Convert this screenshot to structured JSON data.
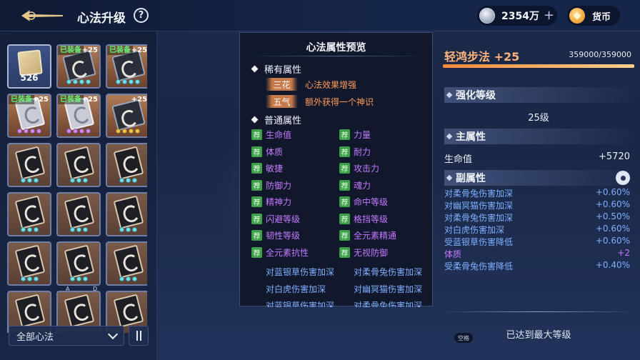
{
  "header": {
    "title": "心法升级",
    "help_label": "?",
    "silver_amount": "2354万",
    "plus_label": "+",
    "gold_label": "货币"
  },
  "inventory": {
    "items": [
      {
        "type": "scroll",
        "count": "526",
        "selected": true
      },
      {
        "type": "book",
        "equip": "已装备",
        "level": "+25",
        "dots": [
          "c",
          "c",
          "c",
          "c"
        ]
      },
      {
        "type": "book",
        "equip": "已装备",
        "level": "+25",
        "dots": [
          "c",
          "c",
          "c",
          "c"
        ]
      },
      {
        "type": "silverbook",
        "equip": "已装备",
        "level": "+25",
        "dots": [
          "p",
          "p",
          "p",
          "p"
        ]
      },
      {
        "type": "silverbook",
        "equip": "已装备",
        "level": "+25",
        "dots": [
          "p",
          "p",
          "p",
          "p"
        ]
      },
      {
        "type": "book",
        "level": "+25",
        "dots": [
          "g",
          "g",
          "g",
          "g"
        ]
      },
      {
        "type": "rune",
        "dots": [
          "c",
          "c",
          "c"
        ]
      },
      {
        "type": "rune",
        "dots": [
          "c",
          "c",
          "c"
        ]
      },
      {
        "type": "rune",
        "dots": [
          "c",
          "c",
          "c"
        ]
      },
      {
        "type": "rune",
        "dots": [
          "c",
          "c",
          "c"
        ]
      },
      {
        "type": "rune",
        "dots": [
          "c",
          "c",
          "c"
        ]
      },
      {
        "type": "rune",
        "dots": [
          "c",
          "c",
          "c"
        ]
      },
      {
        "type": "rune",
        "dots": [
          "c",
          "c",
          "c"
        ]
      },
      {
        "type": "rune",
        "dots": [
          "c",
          "c",
          "c"
        ]
      },
      {
        "type": "rune",
        "dots": [
          "c",
          "c",
          "c"
        ]
      },
      {
        "type": "rune",
        "dots": []
      },
      {
        "type": "rune",
        "dots": []
      },
      {
        "type": "rune",
        "dots": []
      }
    ],
    "key_hints": [
      "A",
      "D"
    ],
    "filter_label": "全部心法"
  },
  "preview": {
    "title": "心法属性预览",
    "rare_title": "稀有属性",
    "rare": [
      {
        "tag": "三花",
        "text": "心法效果增强"
      },
      {
        "tag": "五气",
        "text": "额外获得一个神识"
      }
    ],
    "normal_title": "普通属性",
    "rec_label": "荐",
    "attrs": [
      "生命值",
      "力量",
      "体质",
      "耐力",
      "敏捷",
      "攻击力",
      "防御力",
      "魂力",
      "精神力",
      "命中等级",
      "闪避等级",
      "格挡等级",
      "韧性等级",
      "全元素精通",
      "全元素抗性",
      "无视防御"
    ],
    "blue_attrs": [
      "对蓝银草伤害加深",
      "对柔骨兔伤害加深",
      "对白虎伤害加深",
      "对幽冥猫伤害加深",
      "对蓝银草伤害加深",
      "对柔骨兔伤害加深"
    ]
  },
  "detail": {
    "skill_name": "轻鸿步法 +25",
    "exp": "359000/359000",
    "exp_progress": 1.0,
    "enhance_title": "强化等级",
    "enhance_value": "25级",
    "main_title": "主属性",
    "main_stat": {
      "name": "生命值",
      "value": "+5720"
    },
    "sub_title": "副属性",
    "sub_stats": [
      {
        "name": "对柔骨兔伤害加深",
        "value": "+0.60%",
        "color": "blue"
      },
      {
        "name": "对幽冥猫伤害加深",
        "value": "+0.60%",
        "color": "blue"
      },
      {
        "name": "对柔骨兔伤害加深",
        "value": "+0.50%",
        "color": "blue"
      },
      {
        "name": "对白虎伤害加深",
        "value": "+0.60%",
        "color": "blue"
      },
      {
        "name": "受蓝银草伤害降低",
        "value": "+0.60%",
        "color": "blue"
      },
      {
        "name": "体质",
        "value": "+2",
        "color": "purple"
      },
      {
        "name": "受柔骨兔伤害降低",
        "value": "+0.40%",
        "color": "blue"
      }
    ],
    "space_key": "空格",
    "max_level_text": "已达到最大等级"
  },
  "colors": {
    "accent_orange": "#ffb27a",
    "attr_purple": "#c479ff",
    "attr_blue": "#7fb0ff",
    "equip_green": "#6cf07a"
  }
}
